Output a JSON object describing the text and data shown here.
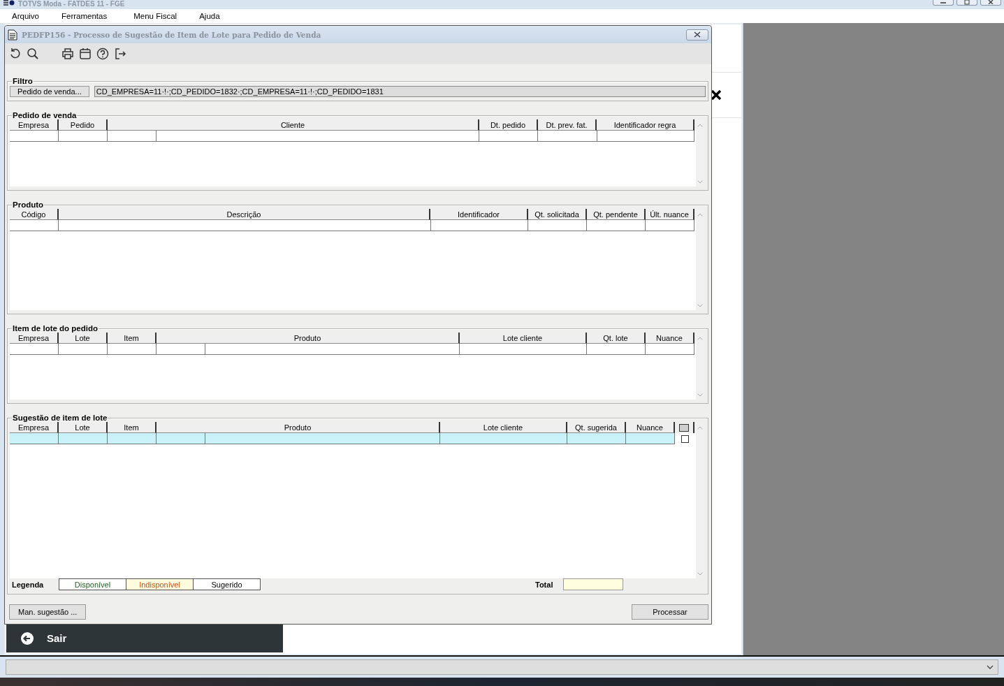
{
  "app_window": {
    "title": "TOTVS Moda - FATDES 11 - FGE"
  },
  "menu": [
    "Arquivo",
    "Ferramentas",
    "Menu Fiscal",
    "Ajuda"
  ],
  "background": {
    "exit_label": "Sair"
  },
  "dialog": {
    "title": "PEDFP156 - Processo de Sugestão de Item de Lote para Pedido de Venda",
    "filter": {
      "legend": "Filtro",
      "button": "Pedido de venda...",
      "value": "CD_EMPRESA=11·!·;CD_PEDIDO=1832·;CD_EMPRESA=11·!·;CD_PEDIDO=1831"
    },
    "grids": [
      {
        "legend": "Pedido de venda",
        "columns": [
          "Empresa",
          "Pedido",
          "Cliente",
          "Dt. pedido",
          "Dt. prev. fat.",
          "Identificador regra"
        ],
        "rows": [
          {
            "selected": false
          }
        ]
      },
      {
        "legend": "Produto",
        "columns": [
          "Código",
          "Descrição",
          "Identificador",
          "Qt. solicitada",
          "Qt. pendente",
          "Últ. nuance"
        ],
        "rows": [
          {
            "selected": false
          }
        ]
      },
      {
        "legend": "Item de lote do pedido",
        "columns": [
          "Empresa",
          "Lote",
          "Item",
          "Produto",
          "Lote cliente",
          "Qt. lote",
          "Nuance"
        ],
        "rows": [
          {
            "selected": false
          }
        ]
      },
      {
        "legend": "Sugestão de item de lote",
        "columns": [
          "Empresa",
          "Lote",
          "Item",
          "Produto",
          "Lote cliente",
          "Qt. sugerida",
          "Nuance"
        ],
        "check_column": {
          "checked": false
        },
        "rows": [
          {
            "selected": true,
            "checked": false
          }
        ]
      }
    ],
    "legend": {
      "label": "Legenda",
      "items": [
        {
          "label": "Disponível",
          "color": "#1f5f1f",
          "shaded": false
        },
        {
          "label": "Indisponível",
          "color": "#c8540a",
          "shaded": true
        },
        {
          "label": "Sugerido",
          "color": "#000000",
          "shaded": false
        }
      ]
    },
    "total": {
      "label": "Total"
    },
    "buttons": [
      "Man. sugestão ...",
      "Processar"
    ]
  }
}
